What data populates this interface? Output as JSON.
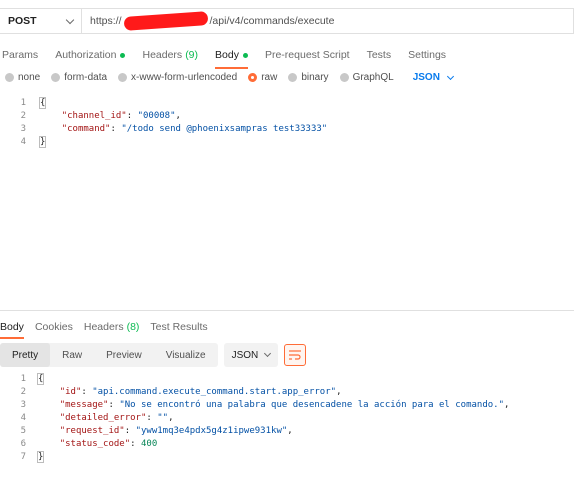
{
  "request": {
    "method": "POST",
    "url_prefix": "https://",
    "url_suffix": "/api/v4/commands/execute"
  },
  "request_tabs": [
    {
      "label": "Params",
      "count": "",
      "dot": false,
      "active": false
    },
    {
      "label": "Authorization",
      "count": "",
      "dot": true,
      "active": false
    },
    {
      "label": "Headers",
      "count": "(9)",
      "dot": false,
      "active": false
    },
    {
      "label": "Body",
      "count": "",
      "dot": true,
      "active": true
    },
    {
      "label": "Pre-request Script",
      "count": "",
      "dot": false,
      "active": false
    },
    {
      "label": "Tests",
      "count": "",
      "dot": false,
      "active": false
    },
    {
      "label": "Settings",
      "count": "",
      "dot": false,
      "active": false
    }
  ],
  "body_types": {
    "options": [
      "none",
      "form-data",
      "x-www-form-urlencoded",
      "raw",
      "binary",
      "GraphQL"
    ],
    "selected": "raw",
    "language": "JSON"
  },
  "request_body": {
    "line_numbers": [
      "1",
      "2",
      "3",
      "4"
    ],
    "open_brace": "{",
    "close_brace": "}",
    "key1": "\"channel_id\"",
    "val1": "\"00008\"",
    "key2": "\"command\"",
    "val2": "\"/todo send @phoenixsampras test33333\""
  },
  "response_tabs": [
    {
      "label": "Body",
      "count": "",
      "active": true
    },
    {
      "label": "Cookies",
      "count": "",
      "active": false
    },
    {
      "label": "Headers",
      "count": "(8)",
      "active": false
    },
    {
      "label": "Test Results",
      "count": "",
      "active": false
    }
  ],
  "view_modes": {
    "options": [
      "Pretty",
      "Raw",
      "Preview",
      "Visualize"
    ],
    "selected": "Pretty",
    "format": "JSON"
  },
  "response_body": {
    "line_numbers": [
      "1",
      "2",
      "3",
      "4",
      "5",
      "6",
      "7"
    ],
    "open_brace": "{",
    "close_brace": "}",
    "key_id": "\"id\"",
    "val_id": "\"api.command.execute_command.start.app_error\"",
    "key_message": "\"message\"",
    "val_message": "\"No se encontró una palabra que desencadene la acción para el comando.\"",
    "key_detailed": "\"detailed_error\"",
    "val_detailed": "\"\"",
    "key_request": "\"request_id\"",
    "val_request": "\"yww1mq3e4pdx5g4z1ipwe931kw\"",
    "key_status": "\"status_code\"",
    "val_status": "400"
  },
  "colors": {
    "accent": "#ff6c37",
    "green": "#0cbb52",
    "blue": "#097bed"
  }
}
